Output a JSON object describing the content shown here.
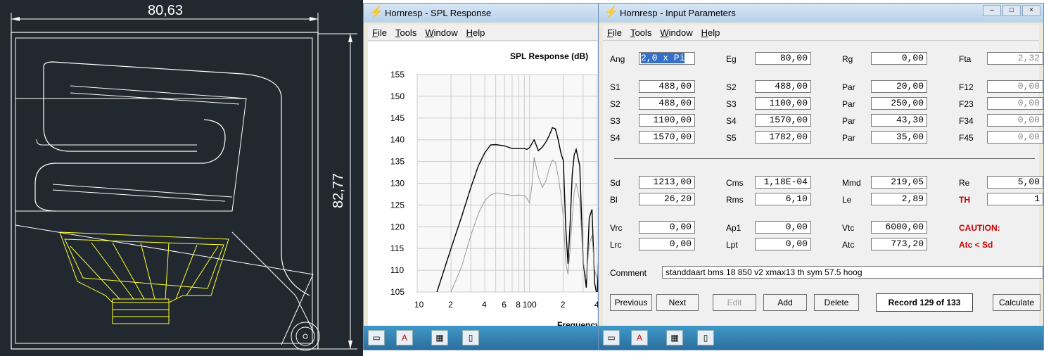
{
  "cad": {
    "dim_width": "80,63",
    "dim_height": "82,77"
  },
  "spl_window": {
    "title": "Hornresp - SPL Response",
    "menu": [
      "File",
      "Tools",
      "Window",
      "Help"
    ],
    "chart_title": "SPL Response (dB)",
    "x_axis_label": "Frequency"
  },
  "input_window": {
    "title": "Hornresp - Input Parameters",
    "menu": [
      "File",
      "Tools",
      "Window",
      "Help"
    ],
    "params": {
      "ang": {
        "label": "Ang",
        "value": "2,0 x Pi"
      },
      "eg": {
        "label": "Eg",
        "value": "80,00"
      },
      "rg": {
        "label": "Rg",
        "value": "0,00"
      },
      "fta": {
        "label": "Fta",
        "value": "2,32"
      },
      "row_s1": {
        "label": "S1",
        "value": "488,00"
      },
      "row_s1b": {
        "label": "S2",
        "value": "488,00"
      },
      "row_s1c": {
        "label": "Par",
        "value": "20,00"
      },
      "row_s1d": {
        "label": "F12",
        "value": "0,00"
      },
      "row_s2": {
        "label": "S2",
        "value": "488,00"
      },
      "row_s2b": {
        "label": "S3",
        "value": "1100,00"
      },
      "row_s2c": {
        "label": "Par",
        "value": "250,00"
      },
      "row_s2d": {
        "label": "F23",
        "value": "0,00"
      },
      "row_s3": {
        "label": "S3",
        "value": "1100,00"
      },
      "row_s3b": {
        "label": "S4",
        "value": "1570,00"
      },
      "row_s3c": {
        "label": "Par",
        "value": "43,30"
      },
      "row_s3d": {
        "label": "F34",
        "value": "0,00"
      },
      "row_s4": {
        "label": "S4",
        "value": "1570,00"
      },
      "row_s4b": {
        "label": "S5",
        "value": "1782,00"
      },
      "row_s4c": {
        "label": "Par",
        "value": "35,00"
      },
      "row_s4d": {
        "label": "F45",
        "value": "0,00"
      },
      "sd": {
        "label": "Sd",
        "value": "1213,00"
      },
      "cms": {
        "label": "Cms",
        "value": "1,18E-04"
      },
      "mmd": {
        "label": "Mmd",
        "value": "219,05"
      },
      "re": {
        "label": "Re",
        "value": "5,00"
      },
      "bl": {
        "label": "Bl",
        "value": "26,20"
      },
      "rms": {
        "label": "Rms",
        "value": "6,10"
      },
      "le": {
        "label": "Le",
        "value": "2,89"
      },
      "th": {
        "label": "TH",
        "value": "1"
      },
      "vrc": {
        "label": "Vrc",
        "value": "0,00"
      },
      "ap1": {
        "label": "Ap1",
        "value": "0,00"
      },
      "vtc": {
        "label": "Vtc",
        "value": "6000,00"
      },
      "lrc": {
        "label": "Lrc",
        "value": "0,00"
      },
      "lpt": {
        "label": "Lpt",
        "value": "0,00"
      },
      "atc": {
        "label": "Atc",
        "value": "773,20"
      }
    },
    "caution_label": "CAUTION:",
    "caution_text": "Atc < Sd",
    "comment_label": "Comment",
    "comment_value": "standdaart bms 18 850 v2 xmax13 th sym 57.5 hoog",
    "buttons": {
      "previous": "Previous",
      "next": "Next",
      "edit": "Edit",
      "add": "Add",
      "delete": "Delete",
      "calculate": "Calculate"
    },
    "record": "Record 129 of 133"
  },
  "chart_data": {
    "type": "line",
    "title": "SPL Response (dB)",
    "xlabel": "Frequency",
    "ylabel": "",
    "x_scale": "log",
    "x_ticks": [
      "10",
      "2",
      "4",
      "6",
      "8",
      "100",
      "2",
      "4"
    ],
    "y_ticks": [
      "155",
      "150",
      "145",
      "140",
      "135",
      "130",
      "125",
      "120",
      "115",
      "110",
      "105"
    ],
    "xlim": [
      10,
      450
    ],
    "ylim": [
      105,
      155
    ],
    "grid": true,
    "series": [
      {
        "color": "#000000",
        "x": [
          15,
          20,
          25,
          30,
          35,
          40,
          45,
          50,
          60,
          70,
          80,
          90,
          95,
          100,
          110,
          120,
          130,
          140,
          150,
          160,
          170,
          180,
          190,
          200,
          210,
          220,
          230,
          240,
          250,
          260,
          280,
          300,
          320,
          340,
          360,
          380,
          400,
          420,
          450
        ],
        "y": [
          105,
          115,
          122.5,
          129,
          134,
          137,
          138.8,
          138.9,
          138.6,
          138,
          138,
          138,
          137.8,
          138.2,
          140,
          137.5,
          138.3,
          139.5,
          141,
          142.8,
          142.5,
          140,
          137,
          135.2,
          120,
          111.5,
          121,
          132,
          136.5,
          137.8,
          134,
          112,
          106,
          122,
          124,
          107,
          104,
          118,
          122
        ]
      },
      {
        "color": "#999999",
        "x": [
          20,
          25,
          30,
          35,
          40,
          45,
          50,
          60,
          70,
          80,
          90,
          95,
          100,
          105,
          110,
          120,
          130,
          140,
          150,
          160,
          170,
          180,
          190,
          200,
          210,
          220,
          230,
          240,
          250,
          260,
          280,
          300,
          320,
          340,
          360,
          380,
          400,
          420,
          450
        ],
        "y": [
          105,
          111,
          118,
          123,
          126,
          127.3,
          127.8,
          127.5,
          127.2,
          127.3,
          127.2,
          126.5,
          125.5,
          129.5,
          136,
          131.5,
          129,
          130.5,
          133.5,
          135.3,
          134.8,
          131.5,
          127.5,
          122,
          112,
          109,
          115,
          122,
          128,
          130,
          126,
          112,
          108,
          116,
          118,
          110,
          108,
          114,
          117
        ]
      }
    ]
  }
}
